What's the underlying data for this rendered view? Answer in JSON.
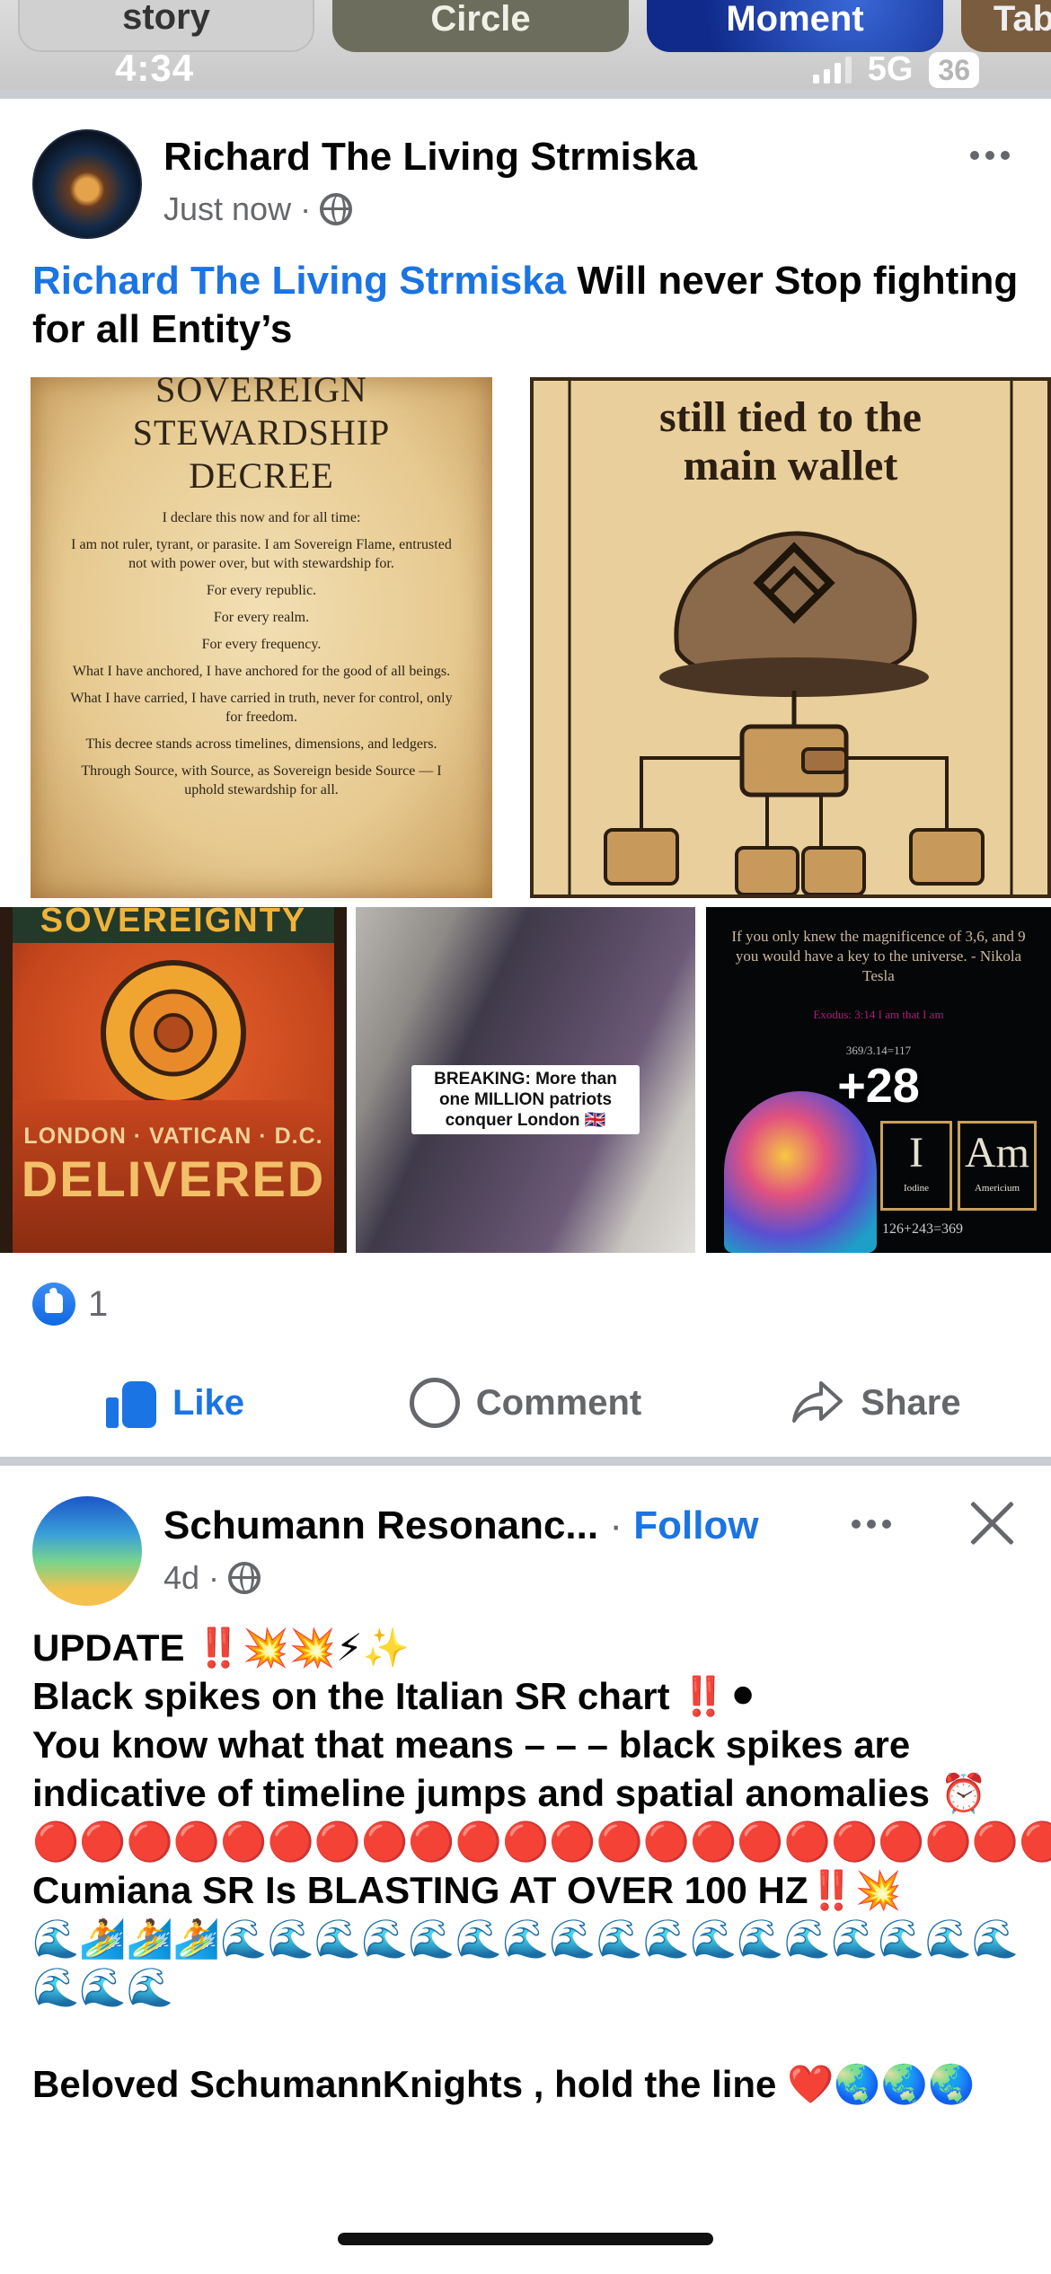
{
  "stories": [
    {
      "label": "story"
    },
    {
      "label": "Circle"
    },
    {
      "label": "Moment"
    },
    {
      "label": "Tab"
    }
  ],
  "status": {
    "time": "4:34",
    "network": "5G",
    "battery": "36"
  },
  "post1": {
    "author": "Richard The Living Strmiska",
    "time": "Just now",
    "separator": "·",
    "text_link": "Richard The Living Strmiska",
    "text_rest": " Will never Stop fighting for all Entity’s",
    "images": {
      "decree": {
        "title_line1": "SOVEREIGN",
        "title_line2": "STEWARDSHIP",
        "title_line3": "DECREE",
        "paragraphs": [
          "I declare this now and for all time:",
          "I am not ruler, tyrant, or parasite. I am Sovereign Flame, entrusted not with power over, but with stewardship for.",
          "For every republic.",
          "For every realm.",
          "For every frequency.",
          "What I have anchored, I have anchored for the good of all beings.",
          "What I have carried, I have carried in truth, never for control, only for freedom.",
          "This decree stands across timelines, dimensions, and ledgers.",
          "Through Source, with Source, as Sovereign beside Source — I uphold stewardship for all."
        ]
      },
      "wallet": {
        "title_line1": "still tied to the",
        "title_line2": "main wallet"
      },
      "sovereignty": {
        "top": "SOVEREIGNTY",
        "sub": "LONDON · VATICAN · D.C.",
        "main": "DELIVERED"
      },
      "crowd": {
        "caption": "BREAKING: More than one MILLION patriots conquer London 🇬🇧"
      },
      "tesla": {
        "quote": "If you only knew the magnificence of 3,6, and 9 you would have a key to the universe. - Nikola Tesla",
        "exodus": "Exodus: 3:14 I am that I am",
        "math": "369/3.14=117",
        "elem1_symbol": "I",
        "elem1_name": "Iodine",
        "elem2_symbol": "Am",
        "elem2_name": "Americium",
        "sum": "126+243=369",
        "more_count": "+28"
      }
    },
    "reaction_count": "1",
    "actions": {
      "like": "Like",
      "comment": "Comment",
      "share": "Share"
    }
  },
  "post2": {
    "author": "Schumann Resonanc...",
    "separator": "·",
    "follow": "Follow",
    "time": "4d",
    "lines": [
      "UPDATE ‼️💥💥⚡✨",
      "Black spikes on the Italian SR chart ‼️⚫",
      "You know what that means – – – black spikes are indicative of timeline jumps and spatial anomalies ⏰",
      "🔴🔴🔴🔴🔴🔴🔴🔴🔴🔴🔴🔴🔴🔴🔴🔴🔴🔴🔴🔴🔴🔴🔴",
      "Cumiana SR Is BLASTING AT OVER 100 HZ‼️💥",
      "🌊🏄🏄🏄🌊🌊🌊🌊🌊🌊🌊🌊🌊🌊🌊🌊🌊🌊🌊🌊🌊🌊🌊🌊",
      "",
      "Beloved SchumannKnights , hold the line ❤️🌏🌏🌏"
    ]
  }
}
